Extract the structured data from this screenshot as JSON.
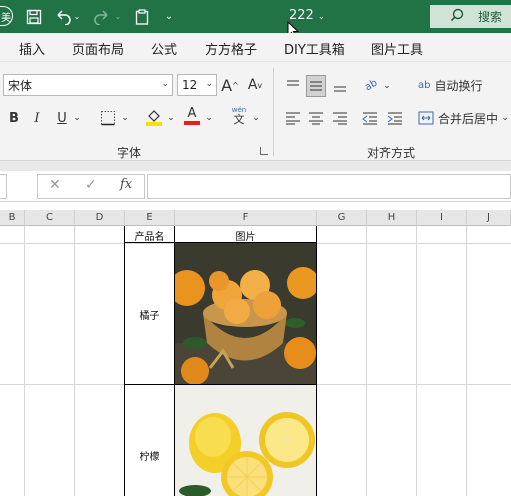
{
  "title_bar": {
    "app_icon_text": "美",
    "document_title": "222",
    "search_label": "搜索"
  },
  "menu": {
    "items": [
      "插入",
      "页面布局",
      "公式",
      "方方格子",
      "DIY工具箱",
      "图片工具"
    ]
  },
  "ribbon": {
    "font_name": "宋体",
    "font_size": "12",
    "grow_font": "A",
    "shrink_font": "A",
    "bold": "B",
    "italic": "I",
    "underline": "U",
    "font_color_letter": "A",
    "wen_label": "wén",
    "wen_char": "文",
    "font_group_label": "字体",
    "wrap_text": "自动换行",
    "merge_center": "合并后居中",
    "align_group_label": "对齐方式",
    "orientation_label": "ab",
    "wrap_icon_label": "ab",
    "highlight_color": "#f5e000",
    "font_color": "#e02020"
  },
  "formula_bar": {
    "cancel": "✕",
    "enter": "✓",
    "fx": "fx",
    "value": ""
  },
  "sheet": {
    "columns": [
      "B",
      "C",
      "D",
      "E",
      "F",
      "G",
      "H",
      "I",
      "J"
    ],
    "header_row": {
      "product_name": "产品名",
      "image": "图片"
    },
    "rows": [
      {
        "name": "橘子",
        "image": "mandarin-oranges-photo"
      },
      {
        "name": "柠檬",
        "image": "lemons-photo"
      }
    ]
  }
}
